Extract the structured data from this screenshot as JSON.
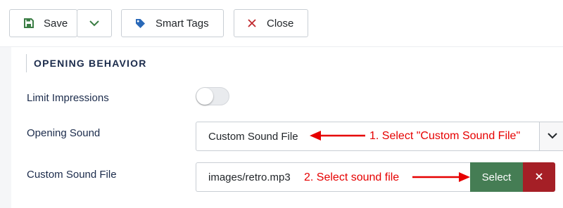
{
  "toolbar": {
    "save_label": "Save",
    "smart_tags_label": "Smart Tags",
    "close_label": "Close",
    "icons": {
      "save": "floppy-disk-icon",
      "dropdown": "chevron-down-icon",
      "smart_tags": "tag-icon",
      "close": "close-x-icon"
    }
  },
  "section": {
    "heading": "OPENING BEHAVIOR"
  },
  "fields": {
    "limit_impressions": {
      "label": "Limit Impressions",
      "toggle_on": false
    },
    "opening_sound": {
      "label": "Opening Sound",
      "selected": "Custom Sound File"
    },
    "custom_sound_file": {
      "label": "Custom Sound File",
      "value": "images/retro.mp3",
      "select_label": "Select",
      "clear_icon": "close-x-icon"
    }
  },
  "annotations": {
    "step1": "1. Select \"Custom Sound File\"",
    "step2": "2. Select sound file"
  },
  "colors": {
    "save_icon": "#3a7d44",
    "tag_icon": "#2a69b8",
    "close_icon": "#c0282d",
    "select_button": "#457d54",
    "clear_button": "#a51f26",
    "annotation": "#e60000",
    "label_text": "#1b2b4b"
  }
}
